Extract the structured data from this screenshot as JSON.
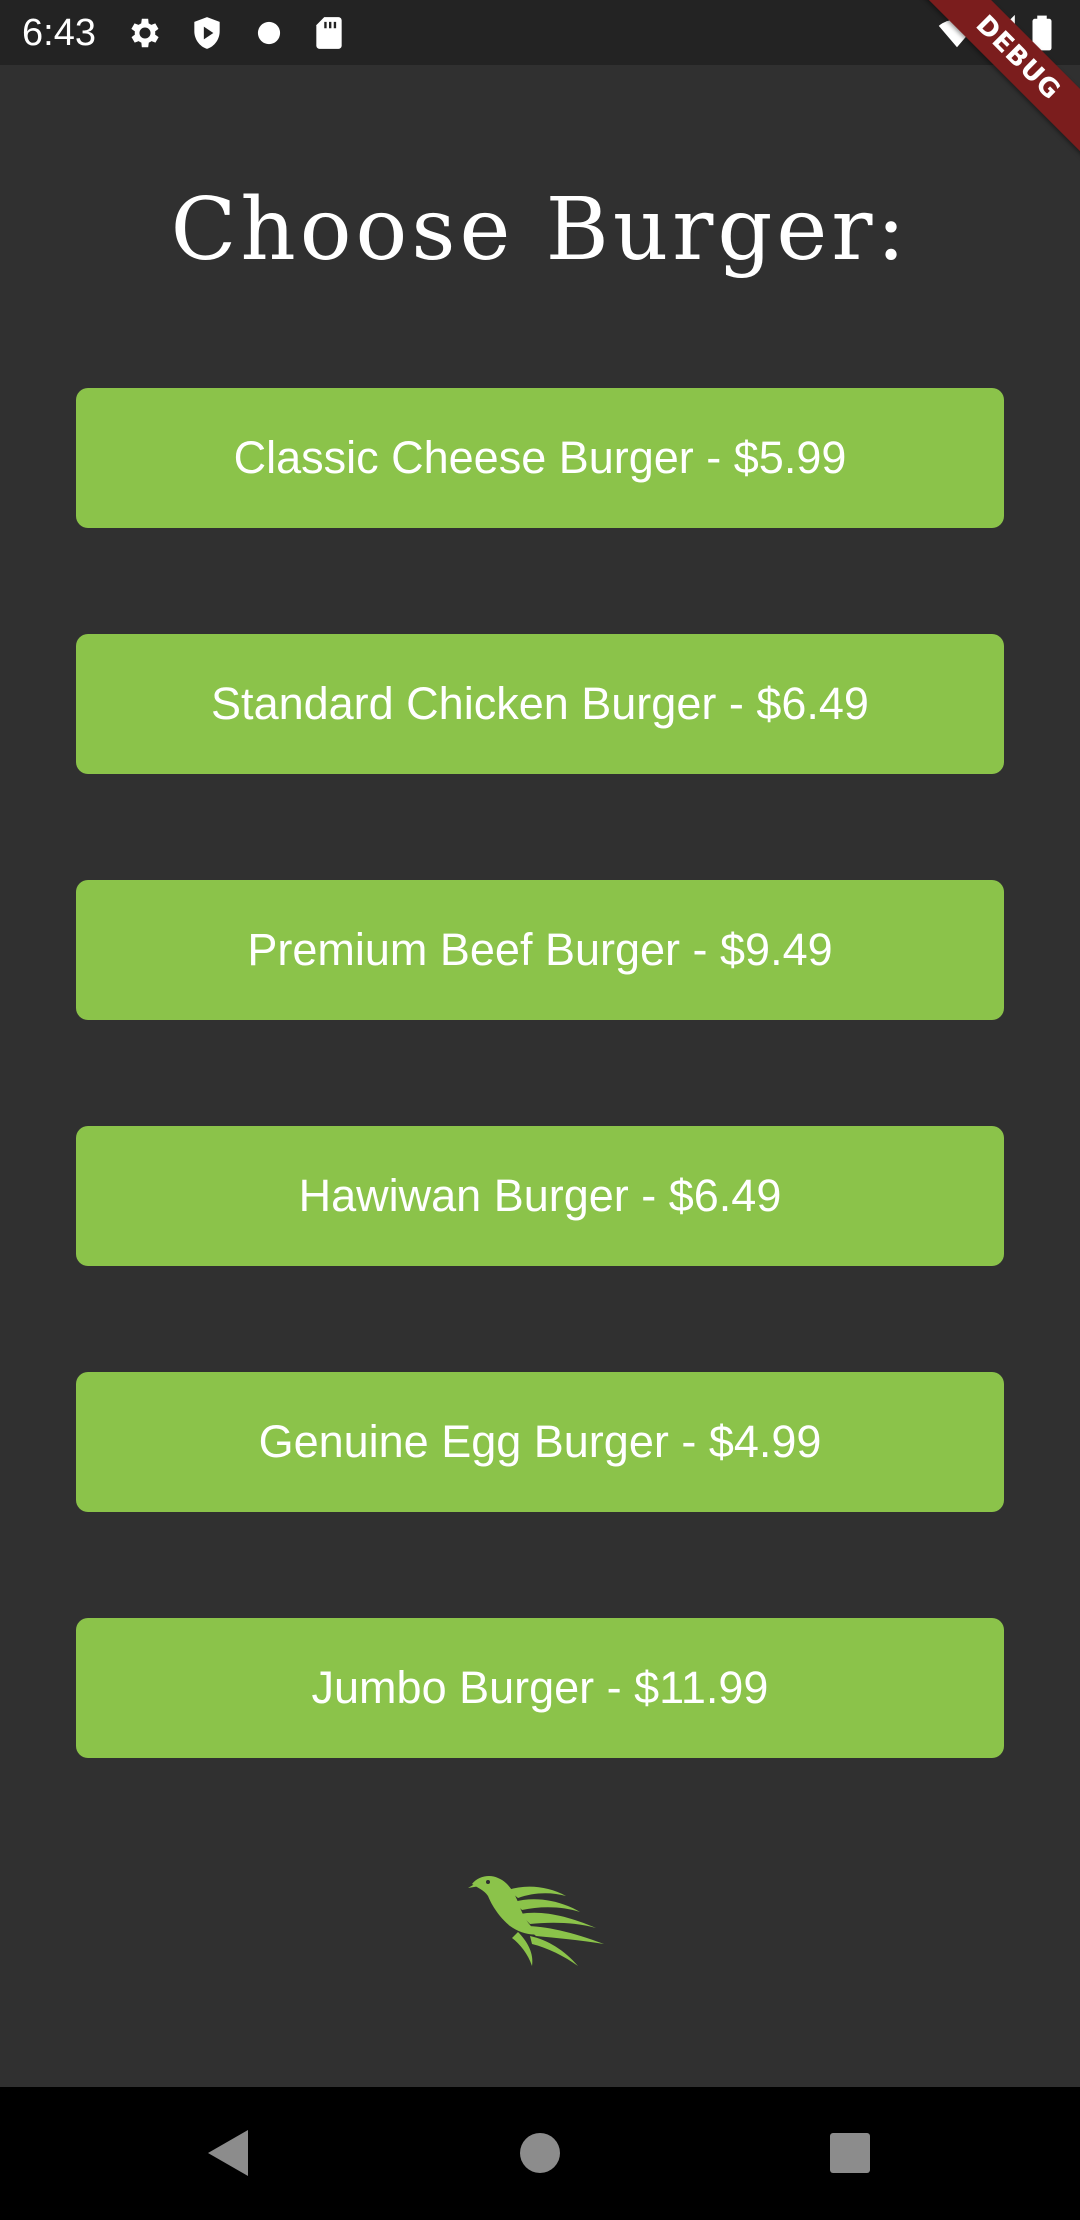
{
  "status_bar": {
    "time": "6:43",
    "icons": [
      "gear-icon",
      "shield-icon",
      "dot-icon",
      "sd-card-icon",
      "wifi-icon",
      "signal-icon",
      "battery-icon"
    ]
  },
  "debug_banner": "DEBUG",
  "title": "Choose Burger:",
  "burgers": [
    {
      "label": "Classic Cheese Burger - $5.99"
    },
    {
      "label": "Standard Chicken Burger - $6.49"
    },
    {
      "label": "Premium Beef Burger - $9.49"
    },
    {
      "label": "Hawiwan Burger - $6.49"
    },
    {
      "label": "Genuine Egg Burger - $4.99"
    },
    {
      "label": "Jumbo Burger - $11.99"
    }
  ],
  "logo": "bird-logo-icon",
  "nav_bar": {
    "icons": [
      "back-icon",
      "home-icon",
      "recents-icon"
    ]
  },
  "colors": {
    "background": "#303030",
    "button": "#8bc34a",
    "status_bar": "#232323",
    "nav_bar": "#000000",
    "debug_banner": "#7b1d1d",
    "text": "#ffffff"
  }
}
